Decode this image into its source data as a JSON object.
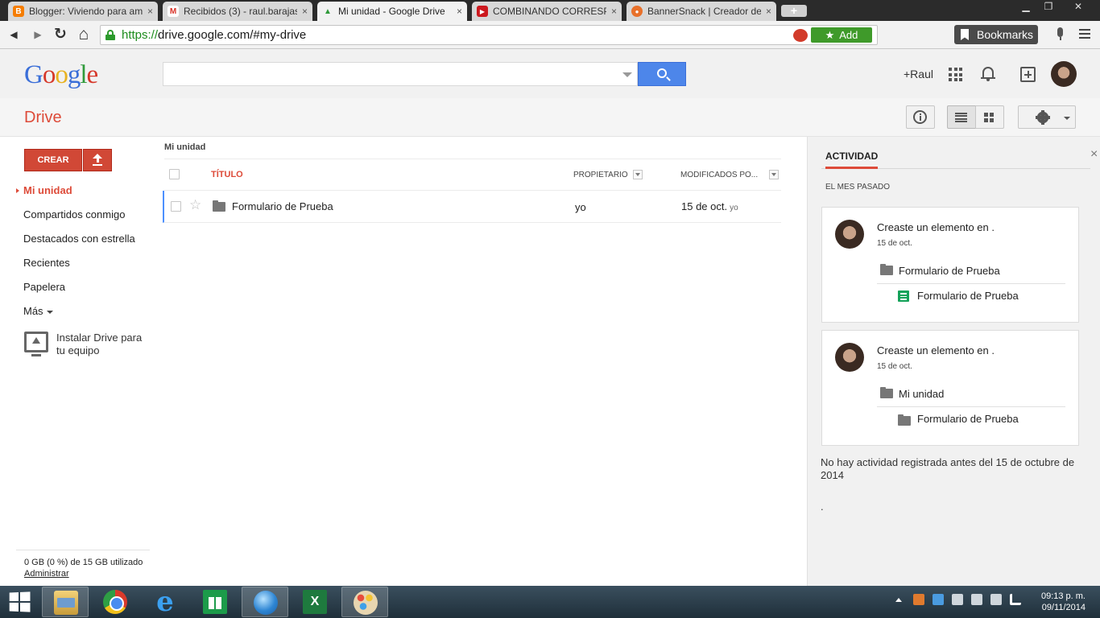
{
  "browser": {
    "tabs": [
      {
        "title": "Blogger: Viviendo para am",
        "favicon": "blogger-icon",
        "color": "#f57d00",
        "glyph": "B"
      },
      {
        "title": "Recibidos (3) - raul.barajas",
        "favicon": "gmail-icon",
        "color": "#d93025",
        "glyph": "M"
      },
      {
        "title": "Mi unidad - Google Drive",
        "favicon": "drive-icon",
        "color": "#2f9a3a",
        "glyph": "▲"
      },
      {
        "title": "COMBINANDO CORRESPO",
        "favicon": "youtube-icon",
        "color": "#cc181e",
        "glyph": "▶"
      },
      {
        "title": "BannerSnack | Creador de",
        "favicon": "bannersnack-icon",
        "color": "#e8702a",
        "glyph": "●"
      }
    ],
    "active_tab": 2,
    "close_glyph": "×",
    "newtab_glyph": "+",
    "window_buttons": {
      "minimize": "▁",
      "restore": "❐",
      "close": "✕"
    },
    "url_scheme": "https://",
    "url_rest": "drive.google.com/#my-drive",
    "add_label": "Add",
    "bookmarks_label": "Bookmarks",
    "nav_glyphs": {
      "back": "◀",
      "forward": "▶",
      "reload": "↻",
      "home": "⌂",
      "star": "★"
    }
  },
  "google_bar": {
    "logo": [
      "G",
      "o",
      "o",
      "g",
      "l",
      "e"
    ],
    "search_value": "",
    "user_label": "+Raul"
  },
  "drive": {
    "title": "Drive"
  },
  "sidebar": {
    "create_label": "CREAR",
    "items": [
      {
        "label": "Mi unidad",
        "active": true
      },
      {
        "label": "Compartidos conmigo",
        "active": false
      },
      {
        "label": "Destacados con estrella",
        "active": false
      },
      {
        "label": "Recientes",
        "active": false
      },
      {
        "label": "Papelera",
        "active": false
      },
      {
        "label": "Más",
        "active": false
      }
    ],
    "install_line1": "Instalar Drive para",
    "install_line2": "tu equipo",
    "storage_text": "0 GB (0 %) de 15 GB utilizado",
    "manage_label": "Administrar"
  },
  "file_list": {
    "breadcrumb": "Mi unidad",
    "columns": {
      "title": "TÍTULO",
      "owner": "PROPIETARIO",
      "modified": "MODIFICADOS PO..."
    },
    "rows": [
      {
        "name": "Formulario de Prueba",
        "owner": "yo",
        "modified": "15 de oct.",
        "modified_by": "yo",
        "starred": false
      }
    ],
    "star_glyph": "☆"
  },
  "activity": {
    "tab_label": "ACTIVIDAD",
    "close_glyph": "×",
    "section_label": "EL MES PASADO",
    "cards": [
      {
        "headline": "Creaste un elemento en .",
        "date": "15 de oct.",
        "parent": "Formulario de Prueba",
        "child": "Formulario de Prueba",
        "child_type": "form"
      },
      {
        "headline": "Creaste un elemento en .",
        "date": "15 de oct.",
        "parent": "Mi unidad",
        "child": "Formulario de Prueba",
        "child_type": "folder"
      }
    ],
    "footer_text": "No hay actividad registrada antes del 15 de octubre de 2014",
    "trailing_dot": "."
  },
  "taskbar": {
    "apps": [
      "file-explorer-icon",
      "chrome-icon",
      "internet-explorer-icon",
      "windows-store-icon",
      "browser-globe-icon",
      "excel-icon",
      "paint-icon"
    ],
    "excel_glyph": "X",
    "ie_glyph": "e",
    "time": "09:13 p. m.",
    "date": "09/11/2014"
  }
}
